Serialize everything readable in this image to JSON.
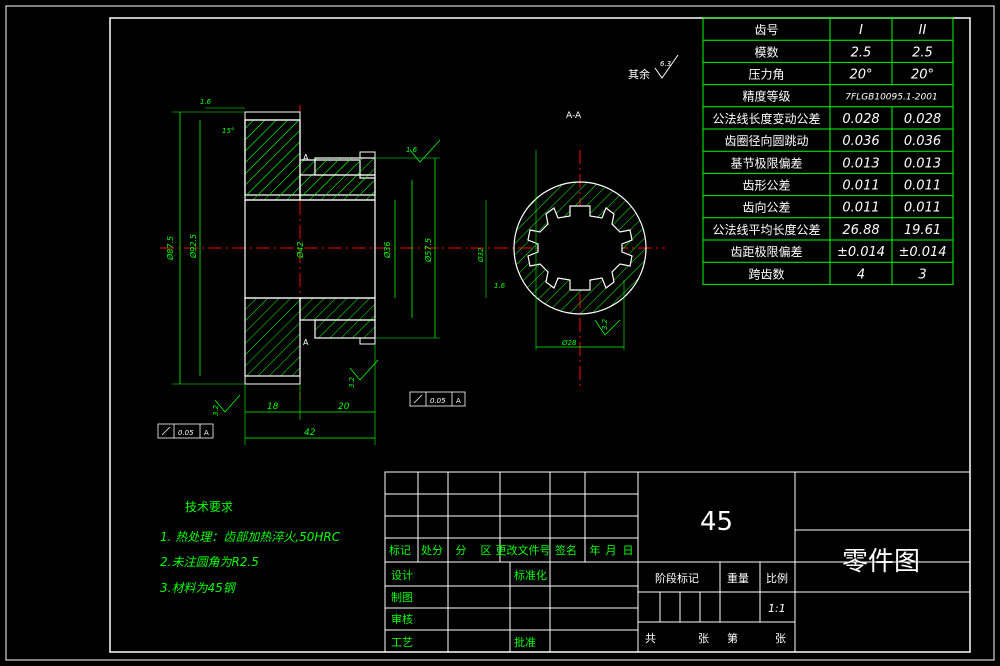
{
  "colors": {
    "background": "#000000",
    "frame": "#ffffff",
    "part_outline": "#ffffff",
    "hatch": "#00ff00",
    "dimension": "#00ff00",
    "centerline": "#ff0000",
    "table_line": "#00ff00",
    "table_text": "#ffffff",
    "notes": "#00ff00"
  },
  "section_label": "A-A",
  "rest_roughness": {
    "label": "其余",
    "value": "6.3"
  },
  "gear_table": {
    "header": [
      "齿号",
      "I",
      "II"
    ],
    "rows": [
      [
        "模数",
        "2.5",
        "2.5"
      ],
      [
        "压力角",
        "20°",
        "20°"
      ],
      [
        "精度等级",
        "7FLGB10095.1-2001",
        ""
      ],
      [
        "公法线长度变动公差",
        "0.028",
        "0.028"
      ],
      [
        "齿圈径向圆跳动",
        "0.036",
        "0.036"
      ],
      [
        "基节极限偏差",
        "0.013",
        "0.013"
      ],
      [
        "齿形公差",
        "0.011",
        "0.011"
      ],
      [
        "齿向公差",
        "0.011",
        "0.011"
      ],
      [
        "公法线平均长度公差",
        "26.88",
        "19.61"
      ],
      [
        "齿距极限偏差",
        "±0.014",
        "±0.014"
      ],
      [
        "跨齿数",
        "4",
        "3"
      ]
    ]
  },
  "tech_requirements": {
    "title": "技术要求",
    "items": [
      "1. 热处理：齿部加热淬火,50HRC",
      "2.未注圆角为R2.5",
      "3.材料为45钢"
    ]
  },
  "title_block": {
    "material": "45",
    "drawing_name": "零件图",
    "rev_headers": [
      "标记",
      "处分",
      "分",
      "区",
      "更改文件号",
      "签名",
      "年",
      "月",
      "日"
    ],
    "design": "设计",
    "standardize": "标准化",
    "draw": "制图",
    "check": "审核",
    "process": "工艺",
    "approve": "批准",
    "stage_mark": "阶段标记",
    "weight": "重量",
    "scale_label": "比例",
    "scale_value": "1:1",
    "sheet_total": "共",
    "sheet_unit": "张",
    "sheet_no": "第",
    "sheet_unit2": "张"
  },
  "dimensions": {
    "d_tip1": "Ø87.5",
    "d_root1": "Ø92.5",
    "d_bore": "Ø42",
    "d_hub": "Ø36",
    "d_tip2": "Ø57.5",
    "w_gear": "18",
    "w_hub": "20",
    "total_length": "42",
    "spline_outer": "Ø28",
    "spline_inner": "Ø32",
    "roughness_32": "3.2",
    "roughness_16": "1.6",
    "roughness_32b": "3.2",
    "tolerance": "0.05",
    "datum": "A",
    "chamfer": "15°",
    "datum_mark": "A"
  }
}
